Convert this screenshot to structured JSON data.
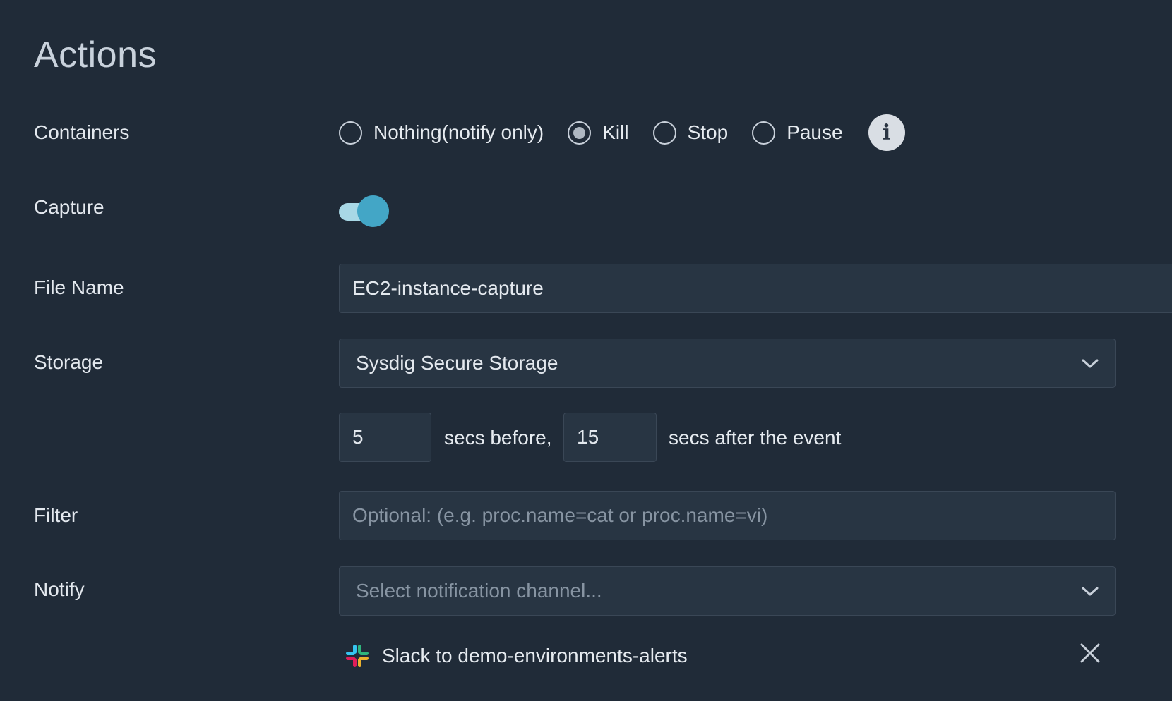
{
  "section": {
    "title": "Actions"
  },
  "containers": {
    "label": "Containers",
    "options": [
      "Nothing(notify only)",
      "Kill",
      "Stop",
      "Pause"
    ],
    "selected": "Kill",
    "info_icon": "i"
  },
  "capture": {
    "label": "Capture",
    "enabled": true,
    "accent_color": "#43a6c6"
  },
  "file_name": {
    "label": "File Name",
    "value": "EC2-instance-capture"
  },
  "storage": {
    "label": "Storage",
    "value": "Sysdig Secure Storage",
    "secs_before": "5",
    "secs_before_text": "secs before,",
    "secs_after": "15",
    "secs_after_text": "secs after the event"
  },
  "filter": {
    "label": "Filter",
    "placeholder": "Optional: (e.g. proc.name=cat or proc.name=vi)"
  },
  "notify": {
    "label": "Notify",
    "placeholder": "Select notification channel...",
    "channels": [
      {
        "icon": "slack-icon",
        "label": "Slack to demo-environments-alerts"
      }
    ]
  }
}
